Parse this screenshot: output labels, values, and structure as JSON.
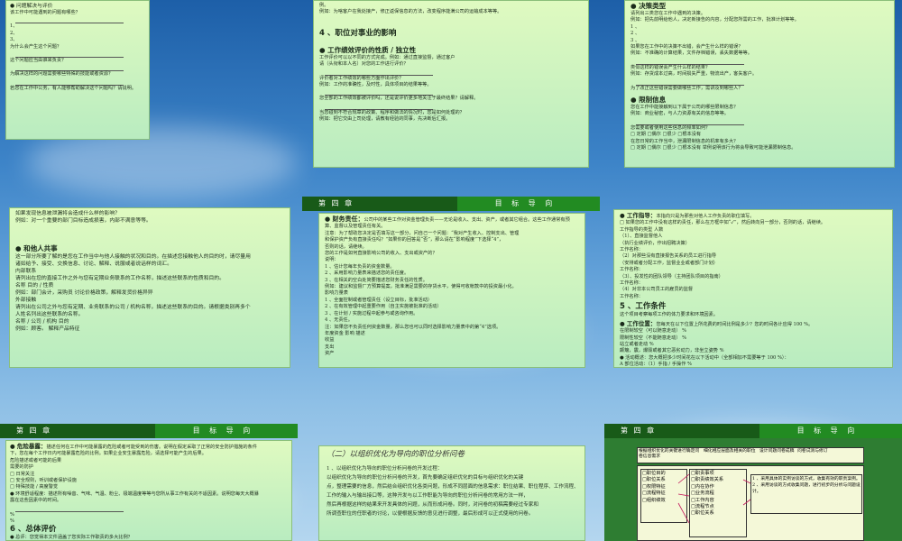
{
  "chapter_label": "第 四 章",
  "guide_label": "目 标 导 向",
  "s1": {
    "heading": "● 问题解决与评价",
    "lines": [
      "该工作中可能遇到的问题有哪些？",
      "",
      "1、",
      "2、",
      "3、",
      "为什么会产生这个问题？",
      "",
      "这个问题应当由谁来负责？",
      "",
      "为解决这样的问题需要哪些特殊的技能或者资源？",
      "",
      "若您在工作中公务，有人能够帮助解决这个问题吗？请说明。"
    ]
  },
  "s2": {
    "top": [
      "例。",
      "例如：为啥客户在我处接产，修正返保信息的方法，改变程序能满公司的运输成本等等。"
    ],
    "section": "4 、职位对事业的影响",
    "heading": "● 工作绩效评价的性质 / 独立性",
    "lines": [
      "工作评价可以以不同的方式完成。例如：通过直接监督，通过客户",
      "请（头衔和本人名）对您的工作进行评价？",
      "",
      "评价者对工作绩效的哪些方面作出评价？",
      "例如：工作的准确性，及时性，具体项目的结果等等。",
      "",
      "您全部的工作绩效都被评价吗，还是说评价更多地关注于最终结果？请解释。",
      "",
      "当您碰到不符合规章的政策、程序和做法的情况时，您是如何处理的？",
      "例如：把它交由上司处理，请教有经验的同事，先决断后汇报。"
    ]
  },
  "s3": {
    "heading1": "● 决策类型",
    "lines1": [
      "请列出三类您在工作中遇到的决策。",
      "例如：把先前明给他人，决定新接告的内容，分配您所需的工作，批准计划等等。",
      "1 、",
      "2 、",
      "3 、",
      "如果您在工作中的决策不出错，会产生什么样的错误？",
      "例如：不准确的计算结果，文件存档错误，丢失数据等等。",
      "",
      "类似这样的错误会产生什么样的结果？",
      "例如：存货成本过高，时间损失严重，物流出产，客失客户。",
      "",
      "为了改正这些错误需要做哪些工作，需讲及到哪些人？"
    ],
    "heading2": "● 限制信息",
    "lines2": [
      "您在工作中能接触到以下属于公司的哪些限制信息？",
      "例如：商业秘密，与人力资源有关的信息等等。",
      "",
      "您需要或者使用这些信息的频率如何？",
      "□ 定期 □偶尔 □很少 □根本没有",
      "在您日常的工作当中，泄漏限制信息的机率有多大？",
      "□ 定期 □偶尔 □很少 □根本没有  举例说明该行为将会导致可能泄漏限制信息。"
    ]
  },
  "s4": {
    "top": [
      "如果发现信息被泄漏将会造成什么样的影响？",
      "例如：对一个重要的部门目标造成损害，内部不满意等等。"
    ],
    "heading": "● 和他人共事",
    "lines": [
      "这一部分所要了解的是您在工作当中与他人接触的状况和目的。在描述您接触他人的目的时，请尽量用",
      "诸如给予、接受、交换信息、讨论、解释、说服或者说话样的词汇。",
      "内部联系",
      "请列出在您的直接工作之外与您有定期业务联系的工作名称，描述这些联系的性质和目的。",
      "名称                        目的 / 性质",
      "例如：部门会计，采购员        讨论价格政策，解释发货价格异异",
      "外部接触",
      "请列出在公司之外与您有定期、业务联系的公司 / 机构名称，描述这些联系的目的。请根据类别再多个",
      "人姓名列出这些联系的名称。",
      "名称 / 公司 / 机构                              目的",
      "例如：顾客。                                        解释产品特征"
    ]
  },
  "s5": {
    "heading": "● 财务责任：",
    "intro": "公司中的某些工作对资金管理负责——无论是收入、支出、资产，或者其它组合。这些工作通常有预算、监督以及管理责任有关。",
    "lines": [
      "注意：为了帮助您决定是否填写这一部分，问自己一个问题：“我对产生收入、控制支出、管理",
      "和保护资产负有直接责任吗？”如果你的回答是“否”，那么请在“影响程度”下选择“4”，",
      "否则的话，请继续。",
      "您的工作是如何直接影响公司的收入、支出或资产的？",
      "说明：",
      "1 、估计您每年负责的资金数量。",
      "2 、采用影响力量表来描述您的责任度。",
      "3 、在相关的空白处简要描述您财务责任的性质。",
      "例如：建议和监督厂方预算提案，批准满足需要的存货水平，使得可收帐款中的投资最小化。",
      "影响力量表",
      "1 、全面控制或者管理责任（设立目标，批准活动）",
      "2 、在有效管理中起重要作用（自主实施被批准的活动）",
      "3 、在计划 / 实施过程中起参与或咨询作用。",
      "4 、无责任。",
      "注：如果您不负责任何资金数量，那么您也可以同时选择影响力量表中的第“4”选项。",
      "年度资金                  影响                         描述",
      "收益",
      "支出",
      "资产"
    ]
  },
  "s6": {
    "heading": "● 工作指导：",
    "intro": "本指向只是为那些对他人工作负责的职位填写。",
    "lines": [
      "□ 如果您的工作中没有这样的责任，那么在方框中如“✓”，然后转向另一部分，否则的话，请继续。",
      "工作指导的类型                                                              人数",
      "（1）、直接监督他人",
      "（执行业绩评价，作出招聘决策）",
      "工作名称：",
      "（2）对那些没有直接报告关系的员工进行指导",
      "（安排或者分配工作，监督业业或者部门计划）",
      "工作名称：",
      "（3）、投发性的团队领导（主持团队项目的指南）",
      "工作名称：",
      "（4）对非本公司员工的雇员的监督",
      "工作名称："
    ],
    "section": "5 、工作条件",
    "lines2": [
      "这个项目考察每项工作的体力要求和环境因素。"
    ],
    "heading2": "● 工作位置：",
    "intro2": "您每天在以下位置上所花费的时间比例是多少？您的时间各计应得 100 %。",
    "lines3": [
      "在限制较空（可以随意走动）                                   %",
      "限制性较空（不能随意走动）                                   %",
      "站立或者走动                                                          %",
      "颠簸，震，爆毁或者其它恶劣动力，非坐立姿势                   %",
      "● 活动概述：您大概把多少时间花在以下活动中（全部相加不需要等于 100 %）：",
      "A 部位活动：（1）手指 / 手操作                       %",
      "                    （2）举 / 背 / 推 / 拉                %",
      "B 移位活动：（1）走路推中                           %",
      "                    （2）爬梯推中                           %"
    ]
  },
  "s7": {
    "heading": "● 危险暴露：",
    "intro": "描述任何在工作中可能暴露的危险或者可能受到的伤害。说明在假定采取了正常的安全防护措施的条件",
    "lines": [
      "下，您在每个工作日内可能暴露危险的比例。如果企业安生暴露危险，请选择可能产生的后果。",
      "危险描述或者可能的后果",
      "                                                         需要的防护",
      "                                                       □ 日常关注",
      "                                                       □ 安全规则，听训或者保护设施",
      "                                                       □ 特殊技能 / 高度警觉",
      "● 环境舒适程度：描述所有噪音、气味、气温、粉尘、极端温度等等与您所从事工作有关的不适因素。说明您每天大概暴",
      "露在这些因素中的时间。",
      "",
      "                                                                          %",
      "                                                                          %"
    ],
    "section": "6 、总体评价",
    "lines2": [
      "● 总评：您觉得本文件涵盖了您实际工作职责的多大比例？",
      "□ 50 %   □ 60 %   □ 70 %   □ 80 %   □ 90 %   □ 100 %"
    ]
  },
  "s8": {
    "title": "（二）以组织优化为导向的职位分析问卷",
    "lines": [
      "1 、以组织优化为导向的职位分析问卷的开发过程：",
      "以组织优化为导向的职位分析问卷的开发，首先要确定组织优化的目标与组织优化的关键",
      "点，整理需要的信息，然后结合组织优化各类问题，形成不同层面的信息需求：职位结果、职位程序、工作流程、",
      "工作的输入与输出接口等，这种开发与以工作职能为导向的职位分析问卷的常用方法一样，",
      "然后再根据这样的结果来开发具体的问题，从而形成问卷。同时，对问卷的初稿需要经过专家和",
      "所调查职位的任职者的讨论，以便根据反馈的意见进行调整，最后形成可以正式使用的问卷。"
    ]
  },
  "s9": {
    "flow_top": [
      "根据组织优化的关键进行确定问卷信息需求",
      "细化相应层面及相关的职位",
      "设计问题问卷成稿",
      "问卷试测与修订"
    ],
    "left_items": [
      "□职位目的",
      "□职位关系",
      "□权限特征",
      "□流程特征",
      "□组织绩效"
    ],
    "mid_items": [
      "□职责事项",
      "□职责绩效关系",
      "□内在协作",
      "□业务流程",
      "□工作内容",
      "□流程节点",
      "□职位关系"
    ],
    "right_notes": [
      "1 、采用具体的实例访谈的方式，收集有效的职责案例。",
      "2 、采用访谈的方式收集问题，进行初步的分析与问题设计。"
    ]
  }
}
